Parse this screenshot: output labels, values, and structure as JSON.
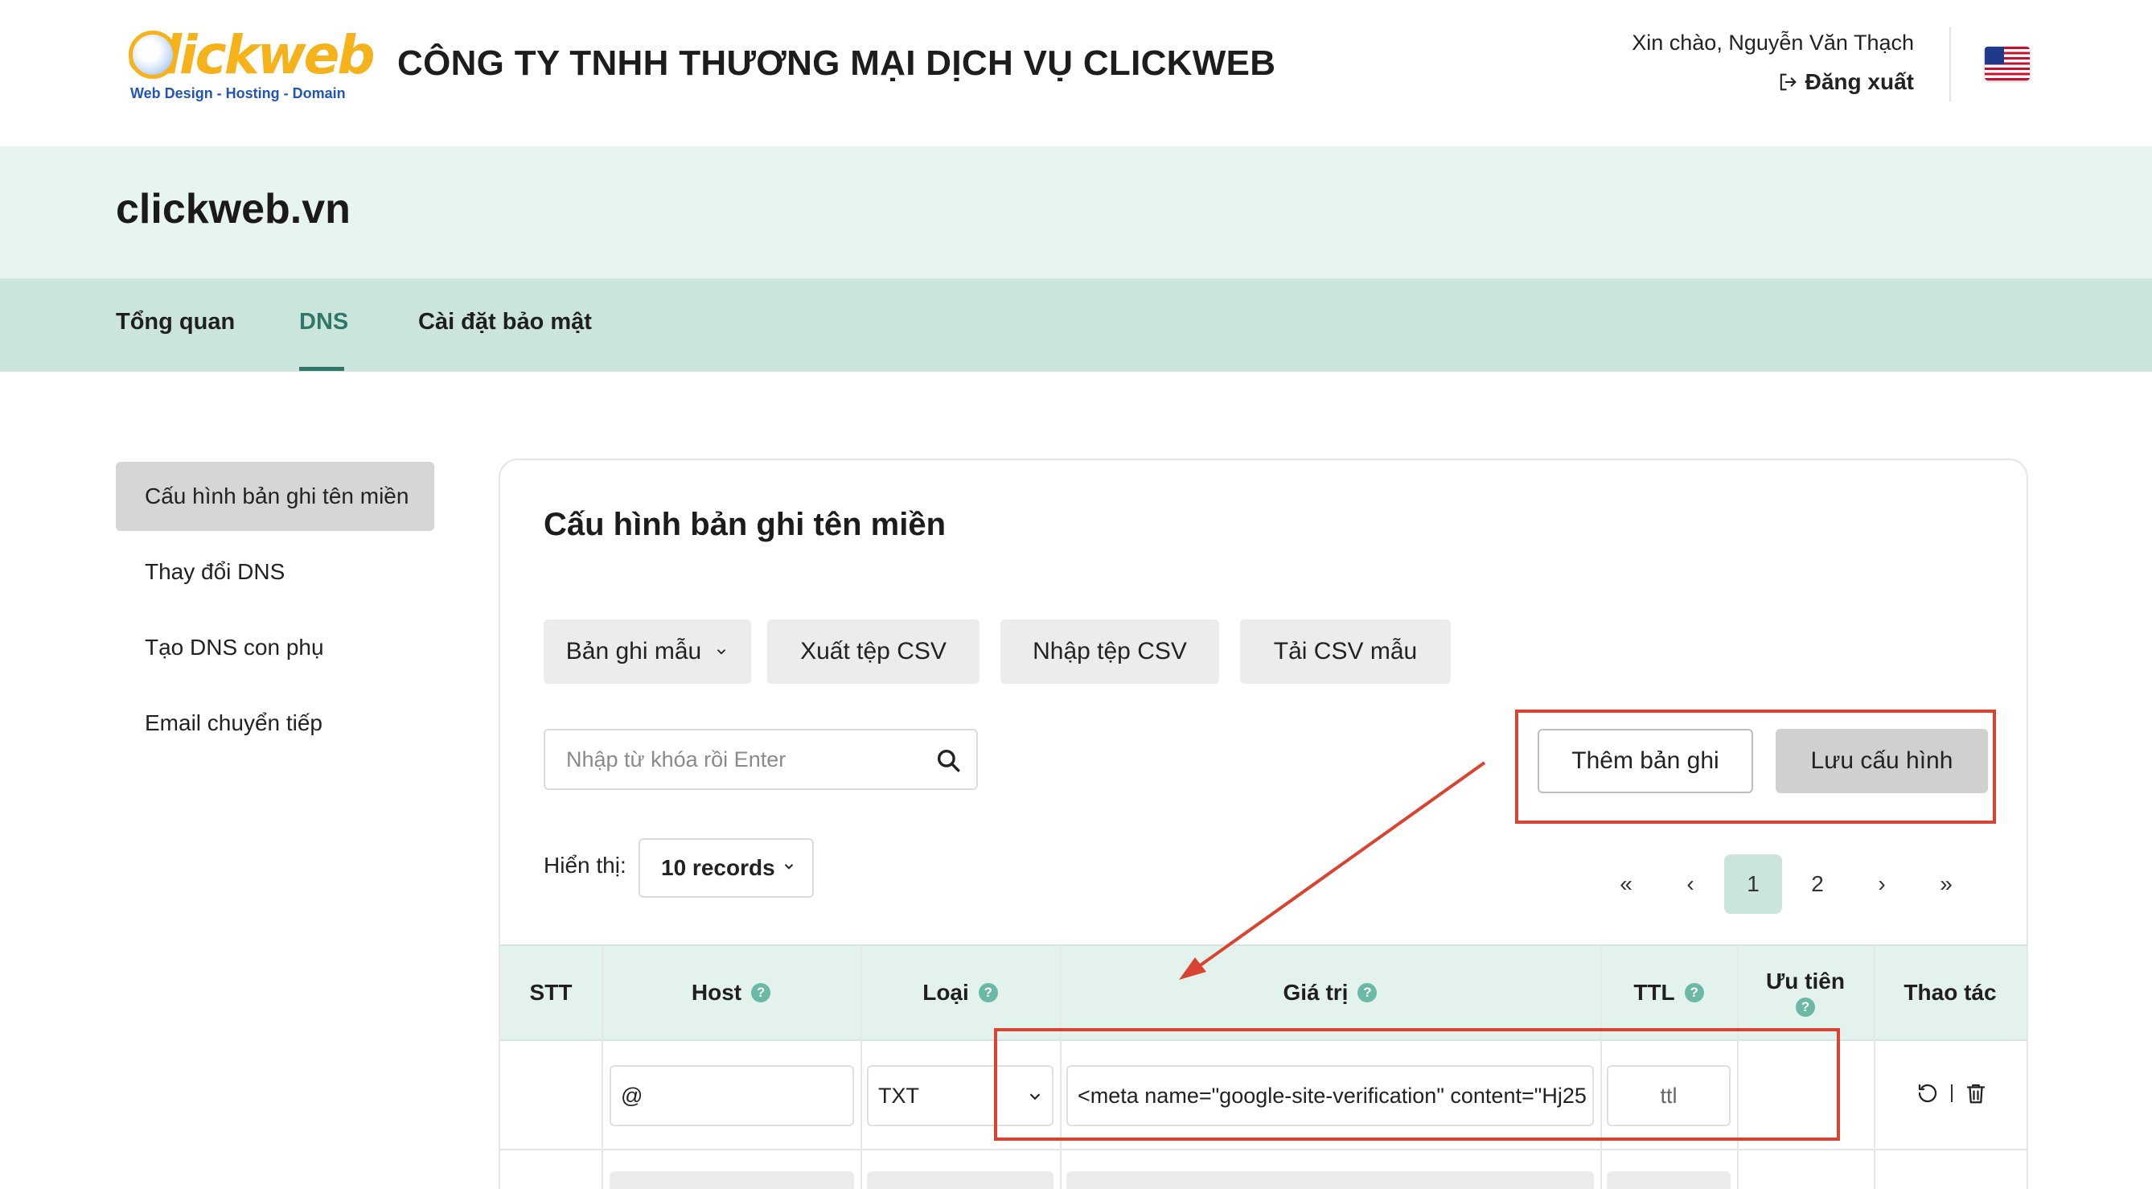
{
  "brand": {
    "logo_word": "Clickweb",
    "logo_tagline": "Web Design - Hosting - Domain",
    "company_name": "CÔNG TY TNHH THƯƠNG MẠI DỊCH VỤ CLICKWEB"
  },
  "user": {
    "greeting": "Xin chào, Nguyễn Văn Thạch",
    "logout_label": "Đăng xuất",
    "language_icon": "us-flag-icon"
  },
  "domain": {
    "name": "clickweb.vn"
  },
  "tabs": [
    {
      "label": "Tổng quan"
    },
    {
      "label": "DNS"
    },
    {
      "label": "Cài đặt bảo mật"
    }
  ],
  "active_tab": "DNS",
  "sidebar": {
    "items": [
      {
        "label": "Cấu hình bản ghi tên miền"
      },
      {
        "label": "Thay đổi DNS"
      },
      {
        "label": "Tạo DNS con phụ"
      },
      {
        "label": "Email chuyển tiếp"
      }
    ]
  },
  "main": {
    "title": "Cấu hình bản ghi tên miền",
    "toolbar": {
      "template_label": "Bản ghi mẫu",
      "export_label": "Xuất tệp CSV",
      "import_label": "Nhập tệp CSV",
      "sample_label": "Tải CSV mẫu"
    },
    "search": {
      "placeholder": "Nhập từ khóa rồi Enter"
    },
    "add_record_label": "Thêm bản ghi",
    "save_config_label": "Lưu cấu hình",
    "show": {
      "label": "Hiển thị:",
      "value": "10 records"
    },
    "pagination": {
      "first": "«",
      "prev": "‹",
      "pages": [
        "1",
        "2"
      ],
      "current": "1",
      "next": "›",
      "last": "»"
    },
    "table": {
      "headers": {
        "stt": "STT",
        "host": "Host",
        "type": "Loại",
        "value": "Giá trị",
        "ttl": "TTL",
        "priority": "Ưu tiên",
        "actions": "Thao tác"
      },
      "rows": [
        {
          "stt": "",
          "host": "@",
          "type": "TXT",
          "value": "<meta name=\"google-site-verification\" content=\"Hj25",
          "ttl_placeholder": "ttl",
          "priority": ""
        }
      ]
    }
  },
  "colors": {
    "accent": "#2f7768",
    "band_light": "#e8f4ef",
    "band_tabs": "#cbe5dd",
    "annotation_red": "#d94432"
  }
}
